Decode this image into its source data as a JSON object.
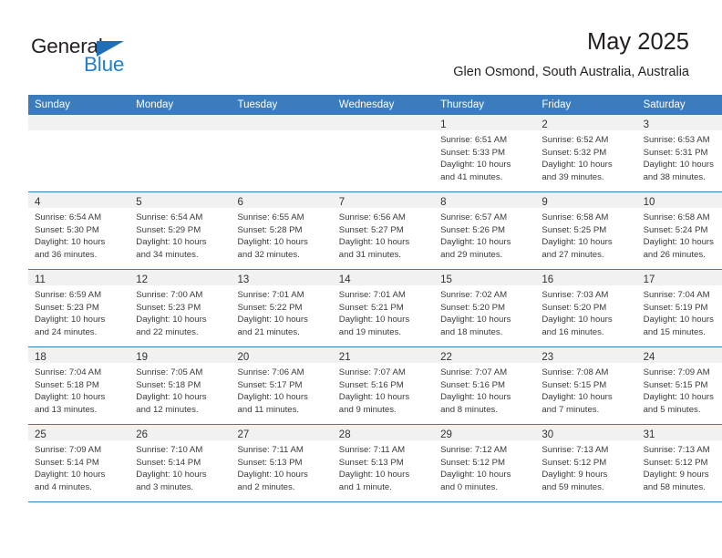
{
  "brand": {
    "name_top": "General",
    "name_bottom": "Blue",
    "accent_color": "#1f7fd0",
    "triangle_color": "#1f6fb8"
  },
  "header": {
    "title": "May 2025",
    "subtitle": "Glen Osmond, South Australia, Australia"
  },
  "theme": {
    "header_row_bg": "#3a7cbe",
    "header_row_text": "#ffffff",
    "daynum_band_bg": "#f1f1f1",
    "cell_bg": "#ffffff",
    "grid_line": "#3a7cbe"
  },
  "weekdays": [
    "Sunday",
    "Monday",
    "Tuesday",
    "Wednesday",
    "Thursday",
    "Friday",
    "Saturday"
  ],
  "weeks": [
    [
      {
        "day": "",
        "lines": []
      },
      {
        "day": "",
        "lines": []
      },
      {
        "day": "",
        "lines": []
      },
      {
        "day": "",
        "lines": []
      },
      {
        "day": "1",
        "lines": [
          "Sunrise: 6:51 AM",
          "Sunset: 5:33 PM",
          "Daylight: 10 hours",
          "and 41 minutes."
        ]
      },
      {
        "day": "2",
        "lines": [
          "Sunrise: 6:52 AM",
          "Sunset: 5:32 PM",
          "Daylight: 10 hours",
          "and 39 minutes."
        ]
      },
      {
        "day": "3",
        "lines": [
          "Sunrise: 6:53 AM",
          "Sunset: 5:31 PM",
          "Daylight: 10 hours",
          "and 38 minutes."
        ]
      }
    ],
    [
      {
        "day": "4",
        "lines": [
          "Sunrise: 6:54 AM",
          "Sunset: 5:30 PM",
          "Daylight: 10 hours",
          "and 36 minutes."
        ]
      },
      {
        "day": "5",
        "lines": [
          "Sunrise: 6:54 AM",
          "Sunset: 5:29 PM",
          "Daylight: 10 hours",
          "and 34 minutes."
        ]
      },
      {
        "day": "6",
        "lines": [
          "Sunrise: 6:55 AM",
          "Sunset: 5:28 PM",
          "Daylight: 10 hours",
          "and 32 minutes."
        ]
      },
      {
        "day": "7",
        "lines": [
          "Sunrise: 6:56 AM",
          "Sunset: 5:27 PM",
          "Daylight: 10 hours",
          "and 31 minutes."
        ]
      },
      {
        "day": "8",
        "lines": [
          "Sunrise: 6:57 AM",
          "Sunset: 5:26 PM",
          "Daylight: 10 hours",
          "and 29 minutes."
        ]
      },
      {
        "day": "9",
        "lines": [
          "Sunrise: 6:58 AM",
          "Sunset: 5:25 PM",
          "Daylight: 10 hours",
          "and 27 minutes."
        ]
      },
      {
        "day": "10",
        "lines": [
          "Sunrise: 6:58 AM",
          "Sunset: 5:24 PM",
          "Daylight: 10 hours",
          "and 26 minutes."
        ]
      }
    ],
    [
      {
        "day": "11",
        "lines": [
          "Sunrise: 6:59 AM",
          "Sunset: 5:23 PM",
          "Daylight: 10 hours",
          "and 24 minutes."
        ]
      },
      {
        "day": "12",
        "lines": [
          "Sunrise: 7:00 AM",
          "Sunset: 5:23 PM",
          "Daylight: 10 hours",
          "and 22 minutes."
        ]
      },
      {
        "day": "13",
        "lines": [
          "Sunrise: 7:01 AM",
          "Sunset: 5:22 PM",
          "Daylight: 10 hours",
          "and 21 minutes."
        ]
      },
      {
        "day": "14",
        "lines": [
          "Sunrise: 7:01 AM",
          "Sunset: 5:21 PM",
          "Daylight: 10 hours",
          "and 19 minutes."
        ]
      },
      {
        "day": "15",
        "lines": [
          "Sunrise: 7:02 AM",
          "Sunset: 5:20 PM",
          "Daylight: 10 hours",
          "and 18 minutes."
        ]
      },
      {
        "day": "16",
        "lines": [
          "Sunrise: 7:03 AM",
          "Sunset: 5:20 PM",
          "Daylight: 10 hours",
          "and 16 minutes."
        ]
      },
      {
        "day": "17",
        "lines": [
          "Sunrise: 7:04 AM",
          "Sunset: 5:19 PM",
          "Daylight: 10 hours",
          "and 15 minutes."
        ]
      }
    ],
    [
      {
        "day": "18",
        "lines": [
          "Sunrise: 7:04 AM",
          "Sunset: 5:18 PM",
          "Daylight: 10 hours",
          "and 13 minutes."
        ]
      },
      {
        "day": "19",
        "lines": [
          "Sunrise: 7:05 AM",
          "Sunset: 5:18 PM",
          "Daylight: 10 hours",
          "and 12 minutes."
        ]
      },
      {
        "day": "20",
        "lines": [
          "Sunrise: 7:06 AM",
          "Sunset: 5:17 PM",
          "Daylight: 10 hours",
          "and 11 minutes."
        ]
      },
      {
        "day": "21",
        "lines": [
          "Sunrise: 7:07 AM",
          "Sunset: 5:16 PM",
          "Daylight: 10 hours",
          "and 9 minutes."
        ]
      },
      {
        "day": "22",
        "lines": [
          "Sunrise: 7:07 AM",
          "Sunset: 5:16 PM",
          "Daylight: 10 hours",
          "and 8 minutes."
        ]
      },
      {
        "day": "23",
        "lines": [
          "Sunrise: 7:08 AM",
          "Sunset: 5:15 PM",
          "Daylight: 10 hours",
          "and 7 minutes."
        ]
      },
      {
        "day": "24",
        "lines": [
          "Sunrise: 7:09 AM",
          "Sunset: 5:15 PM",
          "Daylight: 10 hours",
          "and 5 minutes."
        ]
      }
    ],
    [
      {
        "day": "25",
        "lines": [
          "Sunrise: 7:09 AM",
          "Sunset: 5:14 PM",
          "Daylight: 10 hours",
          "and 4 minutes."
        ]
      },
      {
        "day": "26",
        "lines": [
          "Sunrise: 7:10 AM",
          "Sunset: 5:14 PM",
          "Daylight: 10 hours",
          "and 3 minutes."
        ]
      },
      {
        "day": "27",
        "lines": [
          "Sunrise: 7:11 AM",
          "Sunset: 5:13 PM",
          "Daylight: 10 hours",
          "and 2 minutes."
        ]
      },
      {
        "day": "28",
        "lines": [
          "Sunrise: 7:11 AM",
          "Sunset: 5:13 PM",
          "Daylight: 10 hours",
          "and 1 minute."
        ]
      },
      {
        "day": "29",
        "lines": [
          "Sunrise: 7:12 AM",
          "Sunset: 5:12 PM",
          "Daylight: 10 hours",
          "and 0 minutes."
        ]
      },
      {
        "day": "30",
        "lines": [
          "Sunrise: 7:13 AM",
          "Sunset: 5:12 PM",
          "Daylight: 9 hours",
          "and 59 minutes."
        ]
      },
      {
        "day": "31",
        "lines": [
          "Sunrise: 7:13 AM",
          "Sunset: 5:12 PM",
          "Daylight: 9 hours",
          "and 58 minutes."
        ]
      }
    ]
  ]
}
